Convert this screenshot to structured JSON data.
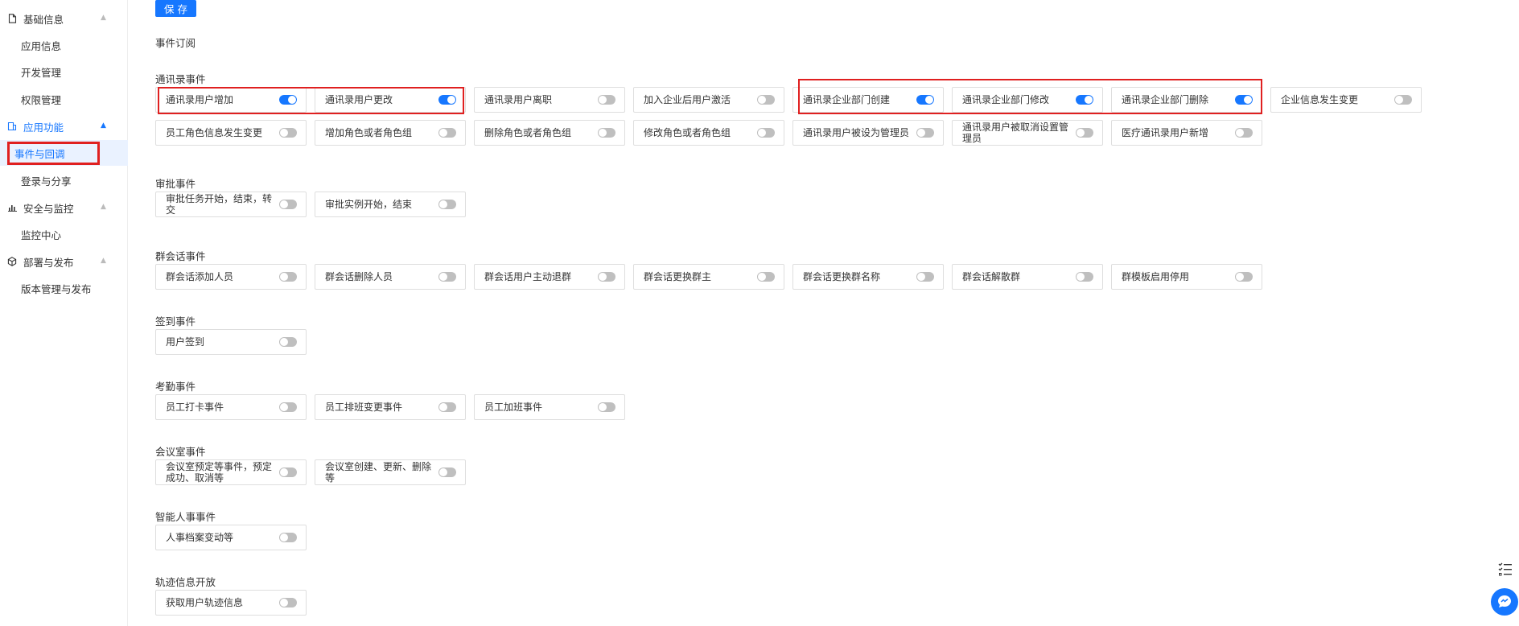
{
  "sidebar": {
    "groups": [
      {
        "label": "基础信息",
        "icon": "document-icon",
        "items": [
          "应用信息",
          "开发管理",
          "权限管理"
        ]
      },
      {
        "label": "应用功能",
        "icon": "app-function-icon",
        "items": [
          "事件与回调",
          "登录与分享"
        ]
      },
      {
        "label": "安全与监控",
        "icon": "bar-chart-icon",
        "items": [
          "监控中心"
        ]
      },
      {
        "label": "部署与发布",
        "icon": "cube-icon",
        "items": [
          "版本管理与发布"
        ]
      }
    ],
    "selected_item": "事件与回调",
    "active_group": "应用功能"
  },
  "toolbar": {
    "save_label": "保存"
  },
  "event_subscription_label": "事件订阅",
  "sections": [
    {
      "title": "通讯录事件",
      "events": [
        {
          "label": "通讯录用户增加",
          "on": true
        },
        {
          "label": "通讯录用户更改",
          "on": true
        },
        {
          "label": "通讯录用户离职",
          "on": false
        },
        {
          "label": "加入企业后用户激活",
          "on": false
        },
        {
          "label": "通讯录企业部门创建",
          "on": true
        },
        {
          "label": "通讯录企业部门修改",
          "on": true
        },
        {
          "label": "通讯录企业部门删除",
          "on": true
        },
        {
          "label": "企业信息发生变更",
          "on": false
        },
        {
          "label": "员工角色信息发生变更",
          "on": false
        },
        {
          "label": "增加角色或者角色组",
          "on": false
        },
        {
          "label": "删除角色或者角色组",
          "on": false
        },
        {
          "label": "修改角色或者角色组",
          "on": false
        },
        {
          "label": "通讯录用户被设为管理员",
          "on": false
        },
        {
          "label": "通讯录用户被取消设置管理员",
          "on": false
        },
        {
          "label": "医疗通讯录用户新增",
          "on": false
        }
      ]
    },
    {
      "title": "审批事件",
      "events": [
        {
          "label": "审批任务开始，结束，转交",
          "on": false
        },
        {
          "label": "审批实例开始，结束",
          "on": false
        }
      ]
    },
    {
      "title": "群会话事件",
      "events": [
        {
          "label": "群会话添加人员",
          "on": false
        },
        {
          "label": "群会话删除人员",
          "on": false
        },
        {
          "label": "群会话用户主动退群",
          "on": false
        },
        {
          "label": "群会话更换群主",
          "on": false
        },
        {
          "label": "群会话更换群名称",
          "on": false
        },
        {
          "label": "群会话解散群",
          "on": false
        },
        {
          "label": "群模板启用停用",
          "on": false
        }
      ]
    },
    {
      "title": "签到事件",
      "events": [
        {
          "label": "用户签到",
          "on": false
        }
      ]
    },
    {
      "title": "考勤事件",
      "events": [
        {
          "label": "员工打卡事件",
          "on": false
        },
        {
          "label": "员工排班变更事件",
          "on": false
        },
        {
          "label": "员工加班事件",
          "on": false
        }
      ]
    },
    {
      "title": "会议室事件",
      "events": [
        {
          "label": "会议室预定等事件，预定成功、取消等",
          "on": false
        },
        {
          "label": "会议室创建、更新、删除等",
          "on": false
        }
      ]
    },
    {
      "title": "智能人事事件",
      "events": [
        {
          "label": "人事档案变动等",
          "on": false
        }
      ]
    },
    {
      "title": "轨迹信息开放",
      "events": [
        {
          "label": "获取用户轨迹信息",
          "on": false
        }
      ]
    }
  ],
  "colors": {
    "accent": "#1677ff",
    "highlight": "#e02020",
    "toggle_off": "#bfbfbf"
  }
}
